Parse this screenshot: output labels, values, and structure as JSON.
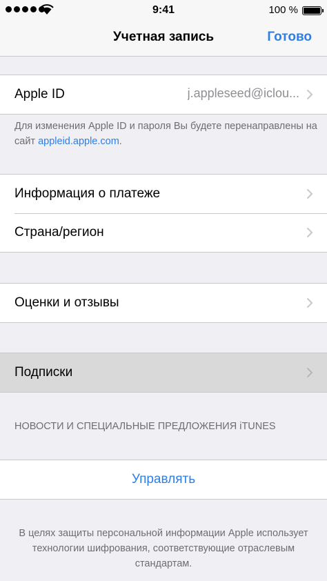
{
  "status_bar": {
    "time": "9:41",
    "battery": "100 %"
  },
  "nav": {
    "title": "Учетная запись",
    "done_label": "Готово"
  },
  "apple_id": {
    "label": "Apple ID",
    "value": "j.appleseed@iclou..."
  },
  "apple_id_note": {
    "text": "Для изменения Apple ID и пароля Вы будете перенаправлены на сайт ",
    "link": "appleid.apple.com",
    "suffix": "."
  },
  "payment_group": {
    "items": [
      {
        "label": "Информация о платеже"
      },
      {
        "label": "Страна/регион"
      }
    ]
  },
  "ratings": {
    "label": "Оценки и отзывы"
  },
  "subscriptions": {
    "label": "Подписки"
  },
  "news_section": {
    "header": "НОВОСТИ И СПЕЦИАЛЬНЫЕ ПРЕДЛОЖЕНИЯ iTUNES",
    "manage_label": "Управлять"
  },
  "footer": {
    "text": "В целях защиты персональной информации Apple использует технологии шифрования, соответствующие отраслевым стандартам."
  },
  "colors": {
    "accent": "#2e7ee6",
    "background": "#efeff4",
    "selected_row": "#d9d9d9"
  }
}
